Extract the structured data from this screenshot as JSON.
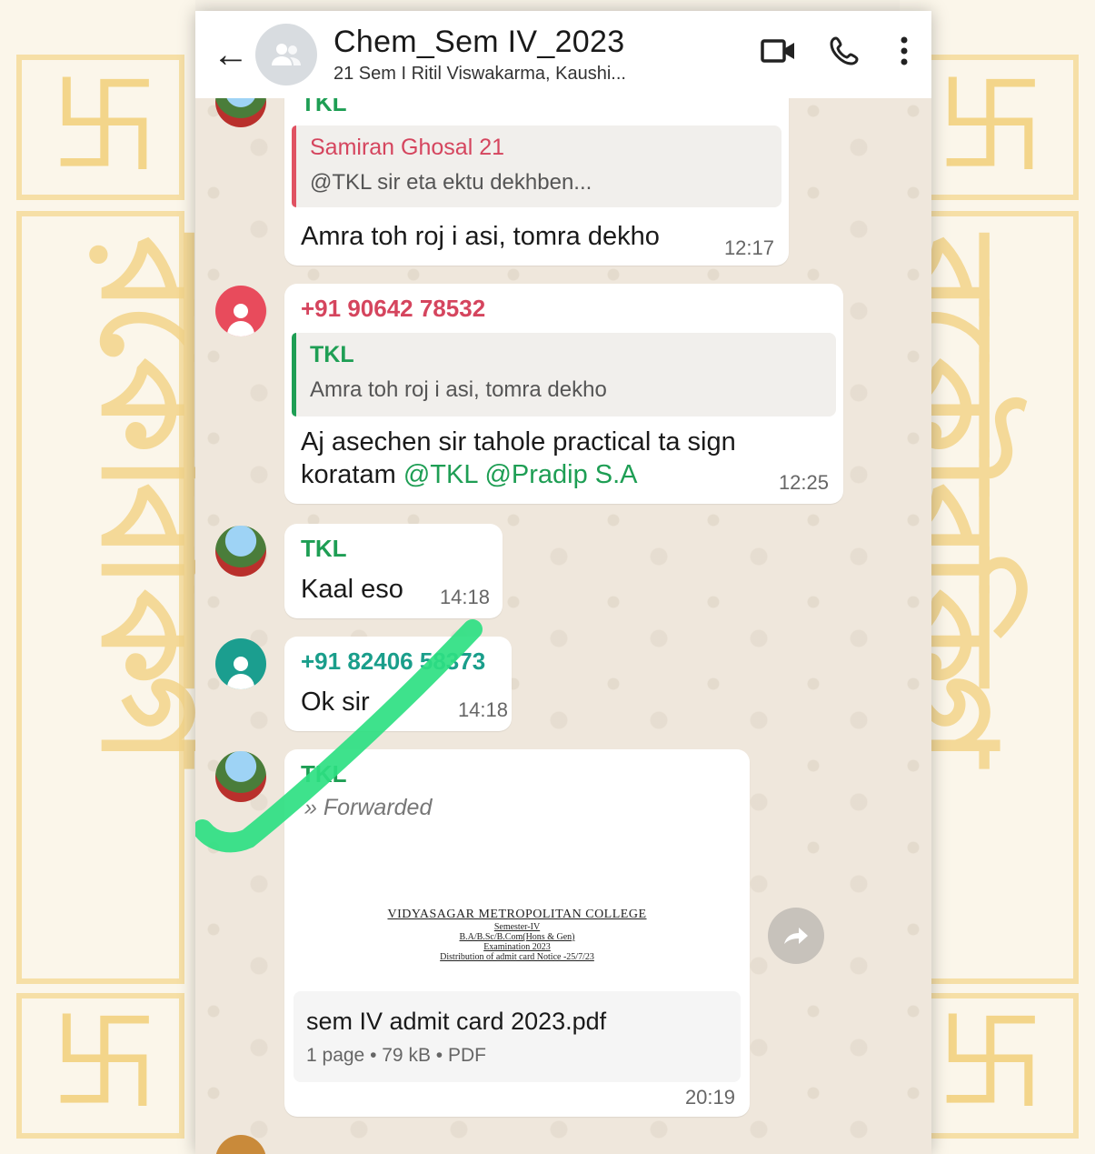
{
  "header": {
    "title": "Chem_Sem IV_2023",
    "subtitle": "21 Sem I  Ritil Viswakarma, Kaushi..."
  },
  "messages": [
    {
      "sender": "TKL",
      "quote_name": "Samiran Ghosal 21",
      "quote_text": "@TKL sir eta ektu dekhben...",
      "body": "Amra toh roj i asi,  tomra dekho",
      "time": "12:17"
    },
    {
      "sender": "+91 90642 78532",
      "quote_name": "TKL",
      "quote_text": "Amra toh roj i asi,  tomra dekho",
      "body_line1": "Aj asechen sir tahole practical ta sign",
      "body_line2_prefix": "koratam ",
      "mention1": "@TKL",
      "mention2": "@Pradip S.A",
      "time": "12:25"
    },
    {
      "sender": "TKL",
      "body": "Kaal eso",
      "time": "14:18"
    },
    {
      "sender": "+91 82406 58373",
      "body": "Ok sir",
      "time": "14:18"
    },
    {
      "sender": "TKL",
      "forwarded": "Forwarded",
      "doc_preview": {
        "line1": "VIDYASAGAR METROPOLITAN COLLEGE",
        "line2": "Semester-IV",
        "line3": "B.A/B.Sc/B.Com(Hons & Gen)",
        "line4": "Examination 2023",
        "line5": "Distribution of admit card Notice -25/7/23"
      },
      "file_name": "sem IV admit card 2023.pdf",
      "file_meta": "1 page • 79 kB • PDF",
      "time": "20:19"
    }
  ],
  "icons": [
    "back-arrow-icon",
    "group-avatar-icon",
    "video-call-icon",
    "voice-call-icon",
    "more-options-icon",
    "forward-icon",
    "share-icon"
  ],
  "colors": {
    "header_bg": "#ffffff",
    "chat_bg": "#efe7dc",
    "mention": "#1e9e54",
    "tick_overlay": "#2ee082"
  }
}
